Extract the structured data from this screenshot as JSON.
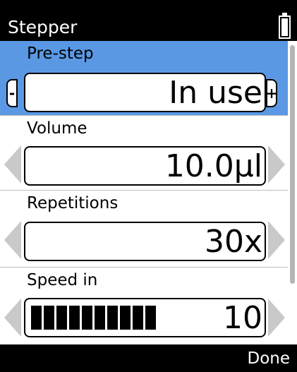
{
  "header": {
    "title": "Stepper",
    "battery_icon": "battery-full-icon"
  },
  "rows": [
    {
      "label": "Pre-step",
      "value": "In use",
      "selected": true
    },
    {
      "label": "Volume",
      "value": "10.0µl",
      "selected": false
    },
    {
      "label": "Repetitions",
      "value": "30x",
      "selected": false
    },
    {
      "label": "Speed in",
      "value": "10",
      "selected": false,
      "level": 10,
      "max_level": 10
    }
  ],
  "controls": {
    "decrease_symbol": "-",
    "increase_symbol": "+"
  },
  "footer": {
    "done_label": "Done"
  },
  "colors": {
    "selected_row": "#5a98e4",
    "arrow_disabled": "#c9c9c9",
    "background": "#000000"
  }
}
